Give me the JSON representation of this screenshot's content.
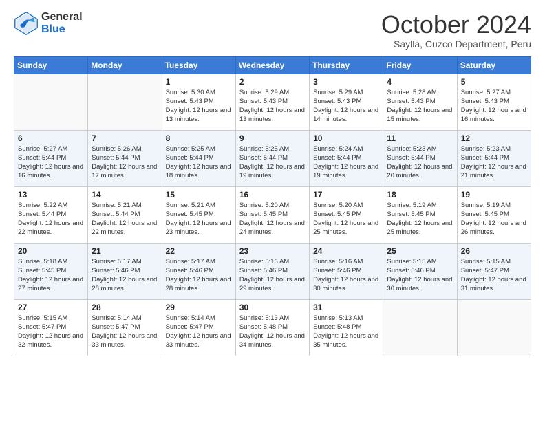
{
  "logo": {
    "general": "General",
    "blue": "Blue"
  },
  "header": {
    "month": "October 2024",
    "location": "Saylla, Cuzco Department, Peru"
  },
  "days_of_week": [
    "Sunday",
    "Monday",
    "Tuesday",
    "Wednesday",
    "Thursday",
    "Friday",
    "Saturday"
  ],
  "weeks": [
    [
      {
        "day": "",
        "sunrise": "",
        "sunset": "",
        "daylight": ""
      },
      {
        "day": "",
        "sunrise": "",
        "sunset": "",
        "daylight": ""
      },
      {
        "day": "1",
        "sunrise": "Sunrise: 5:30 AM",
        "sunset": "Sunset: 5:43 PM",
        "daylight": "Daylight: 12 hours and 13 minutes."
      },
      {
        "day": "2",
        "sunrise": "Sunrise: 5:29 AM",
        "sunset": "Sunset: 5:43 PM",
        "daylight": "Daylight: 12 hours and 13 minutes."
      },
      {
        "day": "3",
        "sunrise": "Sunrise: 5:29 AM",
        "sunset": "Sunset: 5:43 PM",
        "daylight": "Daylight: 12 hours and 14 minutes."
      },
      {
        "day": "4",
        "sunrise": "Sunrise: 5:28 AM",
        "sunset": "Sunset: 5:43 PM",
        "daylight": "Daylight: 12 hours and 15 minutes."
      },
      {
        "day": "5",
        "sunrise": "Sunrise: 5:27 AM",
        "sunset": "Sunset: 5:43 PM",
        "daylight": "Daylight: 12 hours and 16 minutes."
      }
    ],
    [
      {
        "day": "6",
        "sunrise": "Sunrise: 5:27 AM",
        "sunset": "Sunset: 5:44 PM",
        "daylight": "Daylight: 12 hours and 16 minutes."
      },
      {
        "day": "7",
        "sunrise": "Sunrise: 5:26 AM",
        "sunset": "Sunset: 5:44 PM",
        "daylight": "Daylight: 12 hours and 17 minutes."
      },
      {
        "day": "8",
        "sunrise": "Sunrise: 5:25 AM",
        "sunset": "Sunset: 5:44 PM",
        "daylight": "Daylight: 12 hours and 18 minutes."
      },
      {
        "day": "9",
        "sunrise": "Sunrise: 5:25 AM",
        "sunset": "Sunset: 5:44 PM",
        "daylight": "Daylight: 12 hours and 19 minutes."
      },
      {
        "day": "10",
        "sunrise": "Sunrise: 5:24 AM",
        "sunset": "Sunset: 5:44 PM",
        "daylight": "Daylight: 12 hours and 19 minutes."
      },
      {
        "day": "11",
        "sunrise": "Sunrise: 5:23 AM",
        "sunset": "Sunset: 5:44 PM",
        "daylight": "Daylight: 12 hours and 20 minutes."
      },
      {
        "day": "12",
        "sunrise": "Sunrise: 5:23 AM",
        "sunset": "Sunset: 5:44 PM",
        "daylight": "Daylight: 12 hours and 21 minutes."
      }
    ],
    [
      {
        "day": "13",
        "sunrise": "Sunrise: 5:22 AM",
        "sunset": "Sunset: 5:44 PM",
        "daylight": "Daylight: 12 hours and 22 minutes."
      },
      {
        "day": "14",
        "sunrise": "Sunrise: 5:21 AM",
        "sunset": "Sunset: 5:44 PM",
        "daylight": "Daylight: 12 hours and 22 minutes."
      },
      {
        "day": "15",
        "sunrise": "Sunrise: 5:21 AM",
        "sunset": "Sunset: 5:45 PM",
        "daylight": "Daylight: 12 hours and 23 minutes."
      },
      {
        "day": "16",
        "sunrise": "Sunrise: 5:20 AM",
        "sunset": "Sunset: 5:45 PM",
        "daylight": "Daylight: 12 hours and 24 minutes."
      },
      {
        "day": "17",
        "sunrise": "Sunrise: 5:20 AM",
        "sunset": "Sunset: 5:45 PM",
        "daylight": "Daylight: 12 hours and 25 minutes."
      },
      {
        "day": "18",
        "sunrise": "Sunrise: 5:19 AM",
        "sunset": "Sunset: 5:45 PM",
        "daylight": "Daylight: 12 hours and 25 minutes."
      },
      {
        "day": "19",
        "sunrise": "Sunrise: 5:19 AM",
        "sunset": "Sunset: 5:45 PM",
        "daylight": "Daylight: 12 hours and 26 minutes."
      }
    ],
    [
      {
        "day": "20",
        "sunrise": "Sunrise: 5:18 AM",
        "sunset": "Sunset: 5:45 PM",
        "daylight": "Daylight: 12 hours and 27 minutes."
      },
      {
        "day": "21",
        "sunrise": "Sunrise: 5:17 AM",
        "sunset": "Sunset: 5:46 PM",
        "daylight": "Daylight: 12 hours and 28 minutes."
      },
      {
        "day": "22",
        "sunrise": "Sunrise: 5:17 AM",
        "sunset": "Sunset: 5:46 PM",
        "daylight": "Daylight: 12 hours and 28 minutes."
      },
      {
        "day": "23",
        "sunrise": "Sunrise: 5:16 AM",
        "sunset": "Sunset: 5:46 PM",
        "daylight": "Daylight: 12 hours and 29 minutes."
      },
      {
        "day": "24",
        "sunrise": "Sunrise: 5:16 AM",
        "sunset": "Sunset: 5:46 PM",
        "daylight": "Daylight: 12 hours and 30 minutes."
      },
      {
        "day": "25",
        "sunrise": "Sunrise: 5:15 AM",
        "sunset": "Sunset: 5:46 PM",
        "daylight": "Daylight: 12 hours and 30 minutes."
      },
      {
        "day": "26",
        "sunrise": "Sunrise: 5:15 AM",
        "sunset": "Sunset: 5:47 PM",
        "daylight": "Daylight: 12 hours and 31 minutes."
      }
    ],
    [
      {
        "day": "27",
        "sunrise": "Sunrise: 5:15 AM",
        "sunset": "Sunset: 5:47 PM",
        "daylight": "Daylight: 12 hours and 32 minutes."
      },
      {
        "day": "28",
        "sunrise": "Sunrise: 5:14 AM",
        "sunset": "Sunset: 5:47 PM",
        "daylight": "Daylight: 12 hours and 33 minutes."
      },
      {
        "day": "29",
        "sunrise": "Sunrise: 5:14 AM",
        "sunset": "Sunset: 5:47 PM",
        "daylight": "Daylight: 12 hours and 33 minutes."
      },
      {
        "day": "30",
        "sunrise": "Sunrise: 5:13 AM",
        "sunset": "Sunset: 5:48 PM",
        "daylight": "Daylight: 12 hours and 34 minutes."
      },
      {
        "day": "31",
        "sunrise": "Sunrise: 5:13 AM",
        "sunset": "Sunset: 5:48 PM",
        "daylight": "Daylight: 12 hours and 35 minutes."
      },
      {
        "day": "",
        "sunrise": "",
        "sunset": "",
        "daylight": ""
      },
      {
        "day": "",
        "sunrise": "",
        "sunset": "",
        "daylight": ""
      }
    ]
  ]
}
